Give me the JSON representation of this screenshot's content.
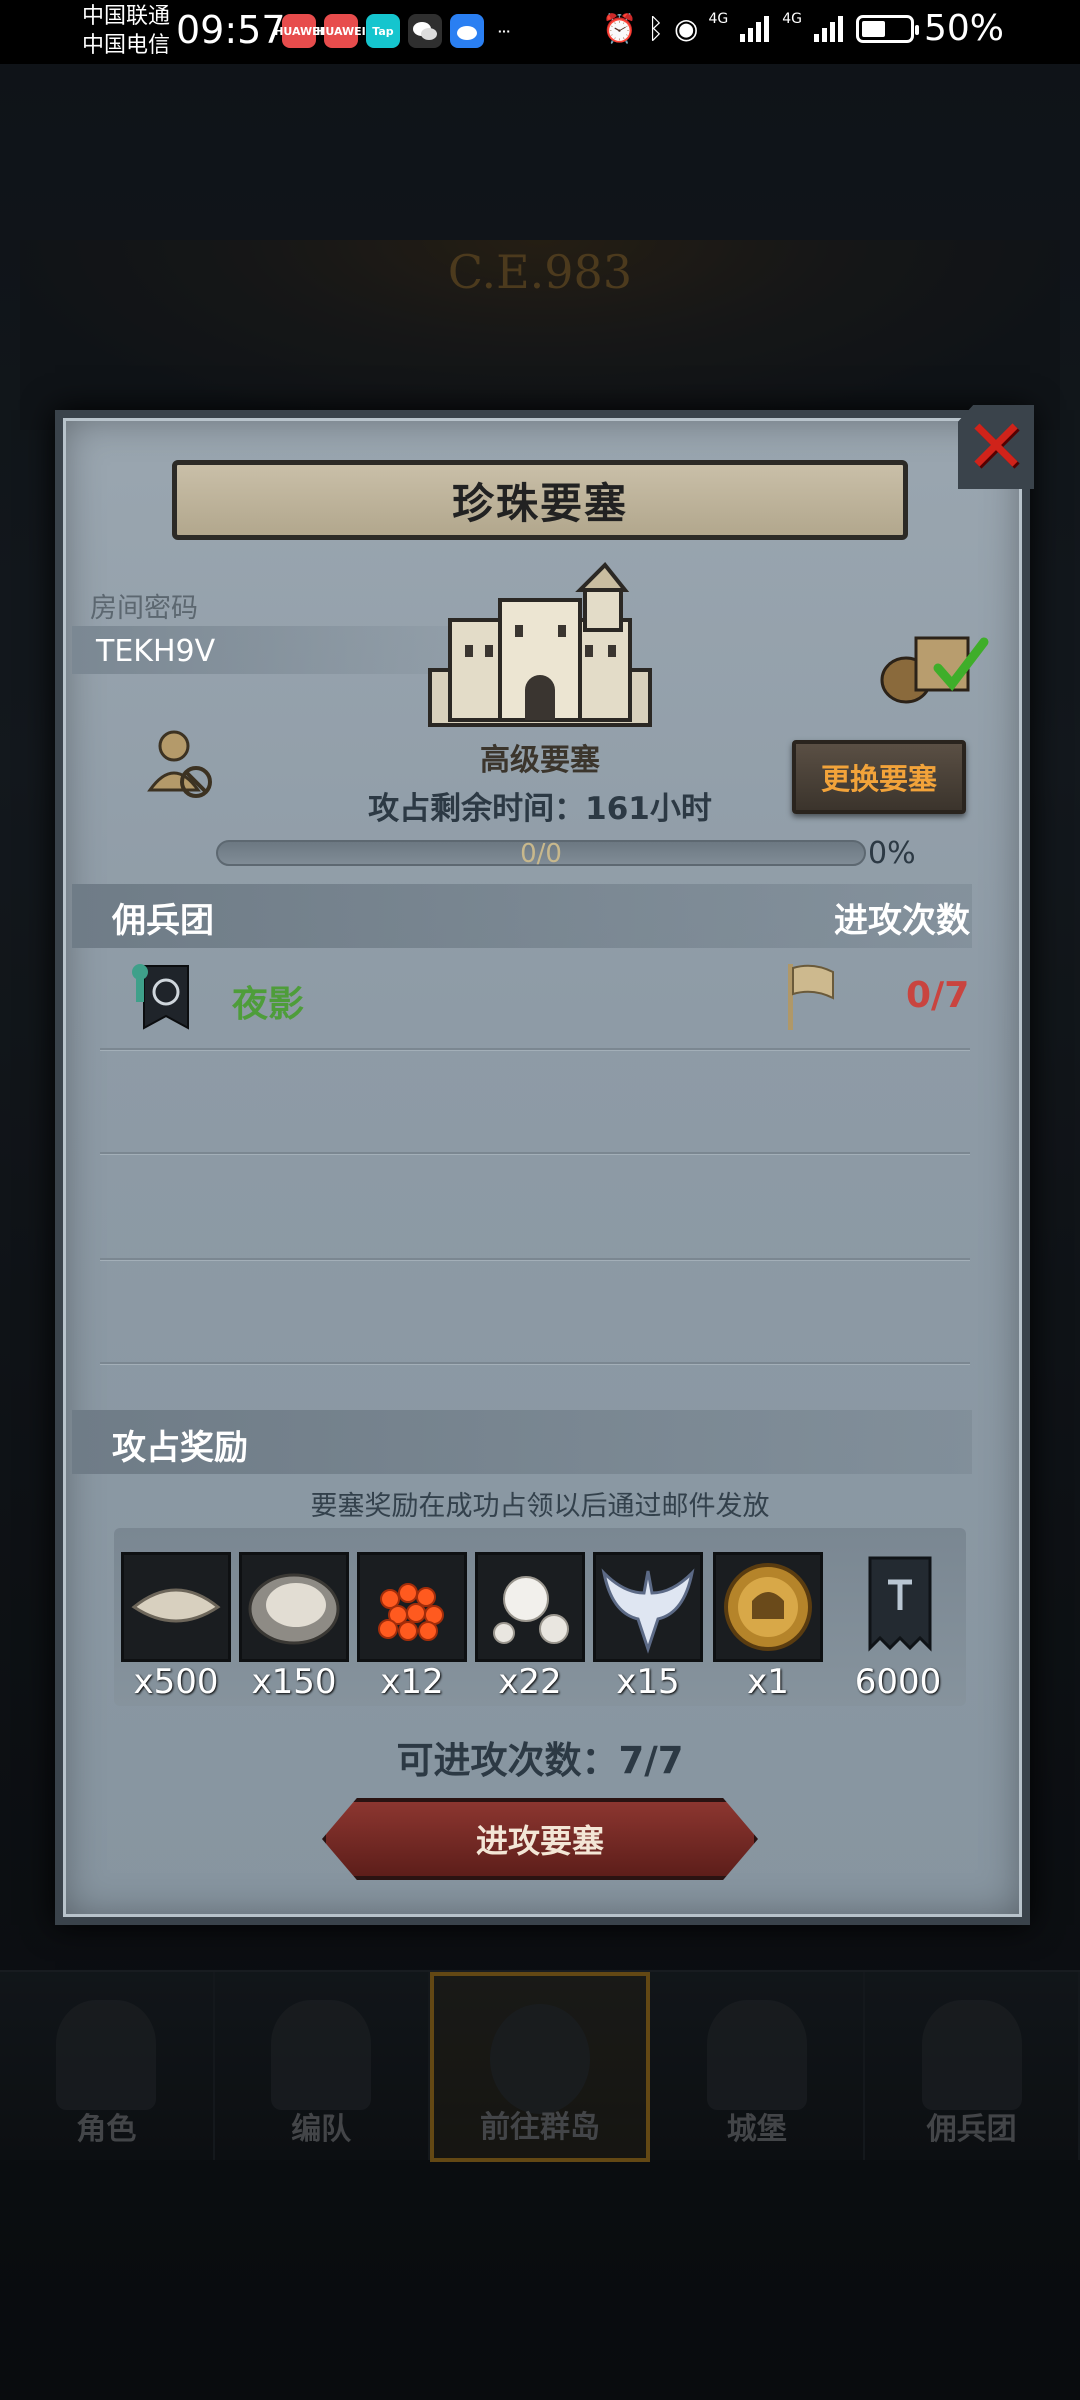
{
  "status_bar": {
    "carrier1": "中国联通",
    "carrier2": "中国电信",
    "time": "09:57",
    "app_icons": [
      {
        "name": "huawei-icon",
        "label": "HUAWEI",
        "color": "#e74c4c"
      },
      {
        "name": "huawei-icon",
        "label": "HUAWEI",
        "color": "#e74c4c"
      },
      {
        "name": "taptap-icon",
        "label": "Tap",
        "color": "#15c5ce"
      },
      {
        "name": "wechat-icon",
        "label": "",
        "color": "#2f2f2f"
      },
      {
        "name": "weibo-icon",
        "label": "",
        "color": "#2a7ff2"
      }
    ],
    "more": "···",
    "net_type1": "4G",
    "net_type2": "4G",
    "battery_percent": "50%",
    "battery_level": 0.5
  },
  "background": {
    "era": "C.E.983",
    "nav": [
      {
        "label": "角色"
      },
      {
        "label": "编队"
      },
      {
        "label": "前往群岛"
      },
      {
        "label": "城堡"
      },
      {
        "label": "佣兵团"
      }
    ]
  },
  "modal": {
    "title": "珍珠要塞",
    "room_label": "房间密码",
    "room_code": "TEKH9V",
    "fortress_level": "高级要塞",
    "change_button": "更换要塞",
    "time_prefix": "攻占剩余时间：",
    "time_value": "161",
    "time_unit": "小时",
    "progress_text": "0/0",
    "progress_percent": "0%",
    "progress_value": 0,
    "mercenary_header": "佣兵团",
    "attack_count_header": "进攻次数",
    "mercenaries": [
      {
        "name": "夜影",
        "count": "0/7"
      }
    ],
    "reward_header": "攻占奖励",
    "reward_note": "要塞奖励在成功占领以后通过邮件发放",
    "rewards": [
      {
        "icon": "oyster-shell-icon",
        "qty": "x500"
      },
      {
        "icon": "oyster-icon",
        "qty": "x150"
      },
      {
        "icon": "fish-roe-icon",
        "qty": "x12"
      },
      {
        "icon": "pearl-icon",
        "qty": "x22"
      },
      {
        "icon": "wing-emblem-icon",
        "qty": "x15"
      },
      {
        "icon": "knight-medal-icon",
        "qty": "x1"
      },
      {
        "icon": "guild-banner-icon",
        "qty": "6000"
      }
    ],
    "attempts_label": "可进攻次数：",
    "attempts_value": "7/7",
    "attack_button": "进攻要塞",
    "colors": {
      "merc_name": "#4e9d3a",
      "attack_count": "#c9443f",
      "change_button_text": "#f2a33a",
      "close_x": "#d0231a"
    }
  }
}
